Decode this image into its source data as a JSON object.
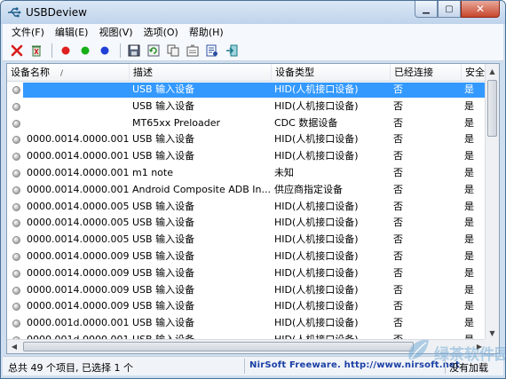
{
  "window": {
    "title": "USBDeview",
    "icons": {
      "app": "usb-icon",
      "minimize": "minimize-icon",
      "maximize": "maximize-icon",
      "close": "close-icon"
    }
  },
  "menu": [
    "文件(F)",
    "编辑(E)",
    "视图(V)",
    "选项(O)",
    "帮助(H)"
  ],
  "toolbar": [
    {
      "name": "disconnect-icon",
      "color": "#d81b1b"
    },
    {
      "name": "uninstall-icon",
      "color": "#3a7a3a"
    },
    {
      "name": "red-dot-icon",
      "color": "#e02020"
    },
    {
      "name": "green-dot-icon",
      "color": "#16b016"
    },
    {
      "name": "blue-dot-icon",
      "color": "#1f3fd8"
    },
    {
      "name": "save-icon",
      "color": "#334"
    },
    {
      "name": "refresh-icon",
      "color": "#2a8a2a"
    },
    {
      "name": "copy-icon",
      "color": "#555"
    },
    {
      "name": "properties-icon",
      "color": "#555"
    },
    {
      "name": "html-report-icon",
      "color": "#2a4fa0"
    },
    {
      "name": "exit-icon",
      "color": "#1a7a8a"
    }
  ],
  "list": {
    "columns": [
      "设备名称",
      "描述",
      "设备类型",
      "已经连接",
      "安全移"
    ],
    "sort_indicator": "/",
    "rows": [
      {
        "name": "",
        "desc": "USB 输入设备",
        "type": "HID(人机接口设备)",
        "connected": "否",
        "safe": "是",
        "selected": true
      },
      {
        "name": "",
        "desc": "USB 输入设备",
        "type": "HID(人机接口设备)",
        "connected": "否",
        "safe": "是"
      },
      {
        "name": "",
        "desc": "MT65xx Preloader",
        "type": "CDC 数据设备",
        "connected": "否",
        "safe": "是"
      },
      {
        "name": "0000.0014.0000.001....",
        "desc": "USB 输入设备",
        "type": "HID(人机接口设备)",
        "connected": "否",
        "safe": "是"
      },
      {
        "name": "0000.0014.0000.001....",
        "desc": "USB 输入设备",
        "type": "HID(人机接口设备)",
        "connected": "否",
        "safe": "是"
      },
      {
        "name": "0000.0014.0000.001....",
        "desc": "m1 note",
        "type": "未知",
        "connected": "否",
        "safe": "是"
      },
      {
        "name": "0000.0014.0000.001....",
        "desc": "Android Composite ADB In...",
        "type": "供应商指定设备",
        "connected": "否",
        "safe": "是"
      },
      {
        "name": "0000.0014.0000.005....",
        "desc": "USB 输入设备",
        "type": "HID(人机接口设备)",
        "connected": "否",
        "safe": "是"
      },
      {
        "name": "0000.0014.0000.005....",
        "desc": "USB 输入设备",
        "type": "HID(人机接口设备)",
        "connected": "否",
        "safe": "是"
      },
      {
        "name": "0000.0014.0000.005....",
        "desc": "USB 输入设备",
        "type": "HID(人机接口设备)",
        "connected": "否",
        "safe": "是"
      },
      {
        "name": "0000.0014.0000.009....",
        "desc": "USB 输入设备",
        "type": "HID(人机接口设备)",
        "connected": "否",
        "safe": "是"
      },
      {
        "name": "0000.0014.0000.009....",
        "desc": "USB 输入设备",
        "type": "HID(人机接口设备)",
        "connected": "否",
        "safe": "是"
      },
      {
        "name": "0000.0014.0000.009....",
        "desc": "USB 输入设备",
        "type": "HID(人机接口设备)",
        "connected": "否",
        "safe": "是"
      },
      {
        "name": "0000.0014.0000.009....",
        "desc": "USB 输入设备",
        "type": "HID(人机接口设备)",
        "connected": "否",
        "safe": "是"
      },
      {
        "name": "0000.001d.0000.001....",
        "desc": "USB 输入设备",
        "type": "HID(人机接口设备)",
        "connected": "否",
        "safe": "是"
      },
      {
        "name": "0000.001d.0000.001....",
        "desc": "USB 输入设备",
        "type": "HID(人机接口设备)",
        "connected": "否",
        "safe": "是"
      }
    ]
  },
  "status": {
    "left": "总共 49 个项目, 已选择 1 个",
    "link": "NirSoft Freeware.  http://www.nirsoft.net",
    "right": "没有加载"
  },
  "watermark": {
    "text": "绿茶软件园",
    "color": "#7ab0d8"
  }
}
